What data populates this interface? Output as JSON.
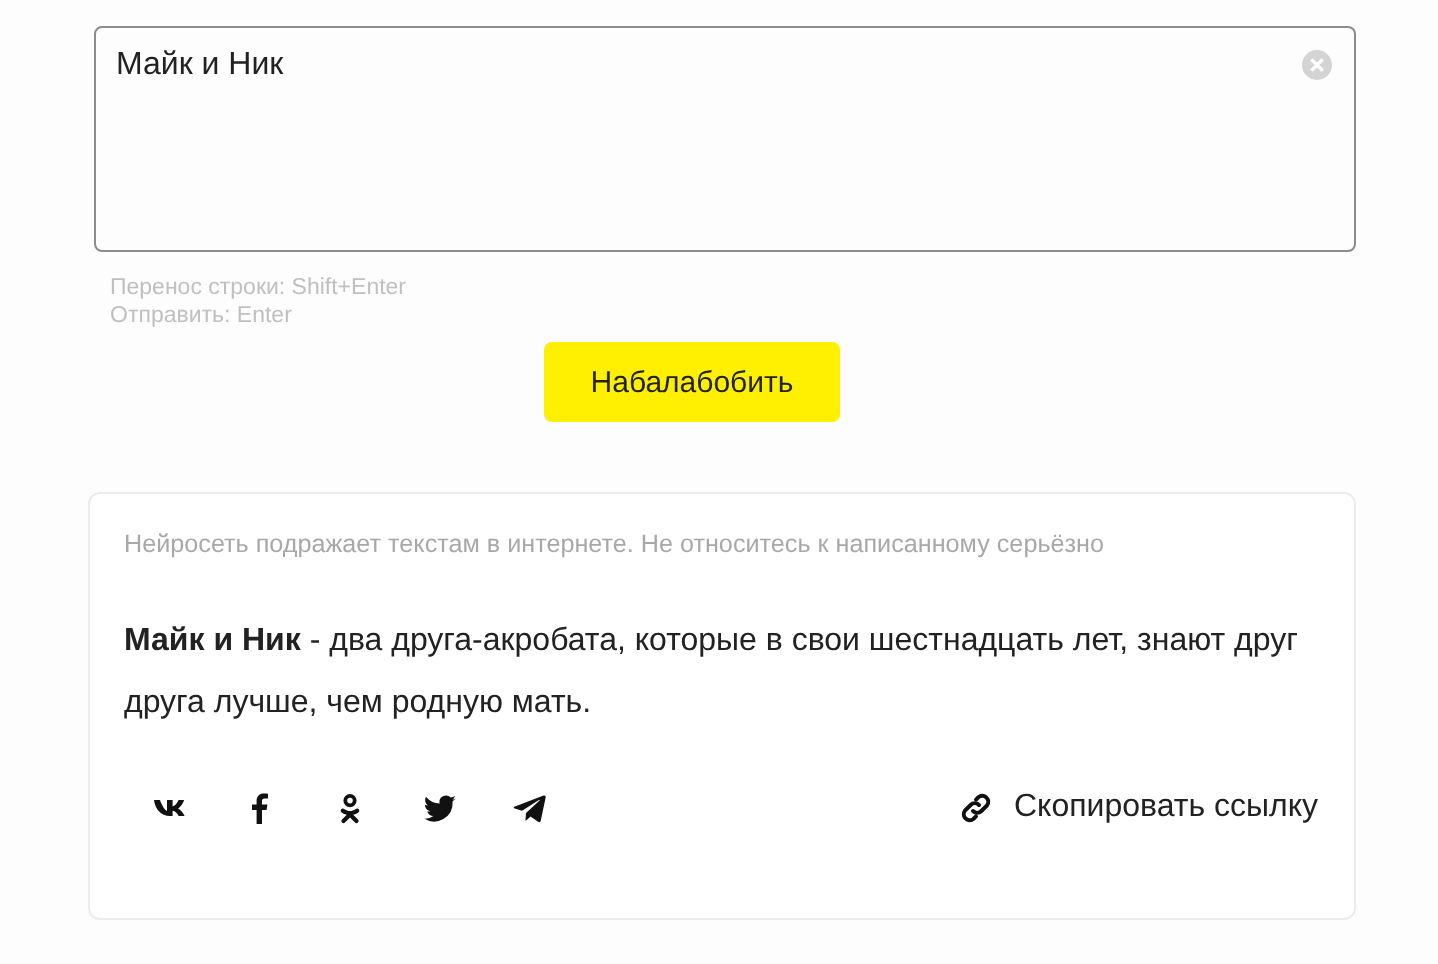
{
  "input": {
    "value": "Майк и Ник"
  },
  "hints": [
    "Перенос строки: Shift+Enter",
    "Отправить: Enter"
  ],
  "submit_button": {
    "label": "Набалабобить"
  },
  "result": {
    "disclaimer": "Нейросеть подражает текстам в интернете. Не относитесь к написанному серьёзно",
    "text": "**Майк и Ник** - два друга-акробата, которые в свои шестнадцать лет, знают друг друга лучше, чем родную мать.",
    "share": [
      {
        "kind": "vk"
      },
      {
        "kind": "facebook"
      },
      {
        "kind": "ok"
      },
      {
        "kind": "twitter"
      },
      {
        "kind": "telegram"
      }
    ],
    "copy_link": {
      "label": "Скопировать ссылку"
    }
  }
}
